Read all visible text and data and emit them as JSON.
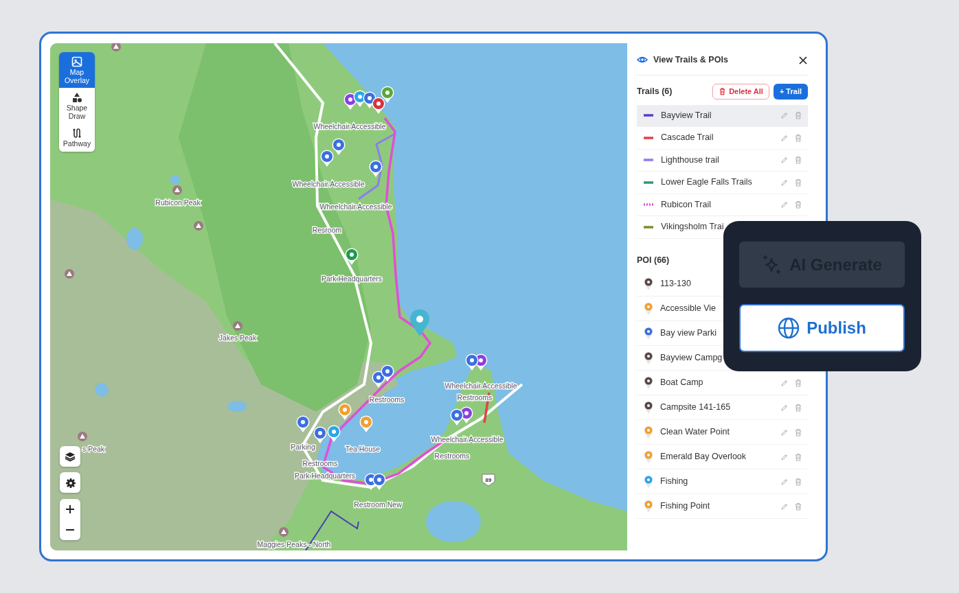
{
  "toolbar": {
    "tools": [
      {
        "label": "Map Overlay",
        "kind": "overlay",
        "selected": true
      },
      {
        "label": "Shape Draw",
        "kind": "shapes",
        "selected": false
      },
      {
        "label": "Pathway",
        "kind": "pathway",
        "selected": false
      }
    ]
  },
  "map": {
    "labels": [
      "Wheelchair Accessible",
      "Wheelchair Accessible",
      "Rubicon Peak",
      "Wheelchair Accessible",
      "Resroom",
      "Park Headquarters",
      "Jakes Peak",
      "Wheelchair Accessible",
      "Restrooms",
      "Restrooms",
      "Wheelchair Accessible",
      "s Peak",
      "Parking",
      "Tea House",
      "Restrooms",
      "Restrooms",
      "Park Headquarters",
      "Restroom New",
      "Maggies Peaks - North"
    ],
    "highway_shield": "89"
  },
  "panel": {
    "title": "View Trails & POIs",
    "trails": {
      "heading": "Trails (6)",
      "delete_all": "Delete All",
      "add_button": "+ Trail",
      "items": [
        {
          "name": "Bayview Trail",
          "color": "#5b3cc4",
          "kind": "solid",
          "selected": true,
          "actions_visible": true
        },
        {
          "name": "Cascade Trail",
          "color": "#e0434a",
          "kind": "solid",
          "selected": false,
          "actions_visible": true
        },
        {
          "name": "Lighthouse trail",
          "color": "#8b7ff0",
          "kind": "solid",
          "selected": false,
          "actions_visible": true
        },
        {
          "name": "Lower Eagle Falls Trails",
          "color": "#2e9a6a",
          "kind": "solid",
          "selected": false,
          "actions_visible": true
        },
        {
          "name": "Rubicon Trail",
          "color": "#e04fd8",
          "kind": "dotted",
          "selected": false,
          "actions_visible": true
        },
        {
          "name": "Vikingsholm Trai",
          "color": "#7d8f2a",
          "kind": "solid",
          "selected": false,
          "actions_visible": false
        }
      ]
    },
    "poi": {
      "heading": "POI (66)",
      "items": [
        {
          "name": "113-130",
          "color": "#5a4646",
          "actions_visible": false
        },
        {
          "name": "Accessible Vie",
          "color": "#f0a030",
          "actions_visible": false
        },
        {
          "name": "Bay view Parki",
          "color": "#3b6fe0",
          "actions_visible": false
        },
        {
          "name": "Bayview Campg",
          "color": "#5a4646",
          "actions_visible": false
        },
        {
          "name": "Boat Camp",
          "color": "#5a4646",
          "actions_visible": true
        },
        {
          "name": "Campsite 141-165",
          "color": "#5a4646",
          "actions_visible": true
        },
        {
          "name": "Clean Water Point",
          "color": "#f0a030",
          "actions_visible": true
        },
        {
          "name": "Emerald Bay Overlook",
          "color": "#f0a030",
          "actions_visible": true
        },
        {
          "name": "Fishing",
          "color": "#2aa6e8",
          "actions_visible": true
        },
        {
          "name": "Fishing Point",
          "color": "#f0a030",
          "actions_visible": true
        }
      ]
    }
  },
  "overlay": {
    "ai_generate": {
      "label": "AI Generate",
      "disabled": true
    },
    "publish": {
      "label": "Publish"
    }
  }
}
